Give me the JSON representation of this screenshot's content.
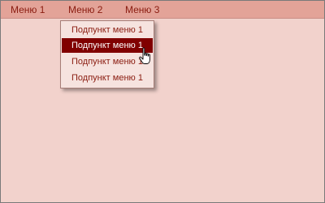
{
  "menubar": {
    "items": [
      {
        "label": "Меню 1"
      },
      {
        "label": "Меню 2"
      },
      {
        "label": "Меню 3"
      }
    ]
  },
  "dropdown": {
    "open_menu": "Меню 2",
    "items": [
      {
        "label": "Подпункт меню 1",
        "selected": false
      },
      {
        "label": "Подпункт меню 1",
        "selected": true
      },
      {
        "label": "Подпункт меню 1",
        "selected": false
      },
      {
        "label": "Подпункт меню 1",
        "selected": false
      }
    ]
  },
  "colors": {
    "menubar_bg": "#e3a398",
    "window_bg": "#f2d2cc",
    "text": "#8a1c10",
    "selected_bg": "#800000",
    "dropdown_bg": "#f6e3df"
  },
  "cursor": {
    "icon": "hand-pointer-icon"
  }
}
